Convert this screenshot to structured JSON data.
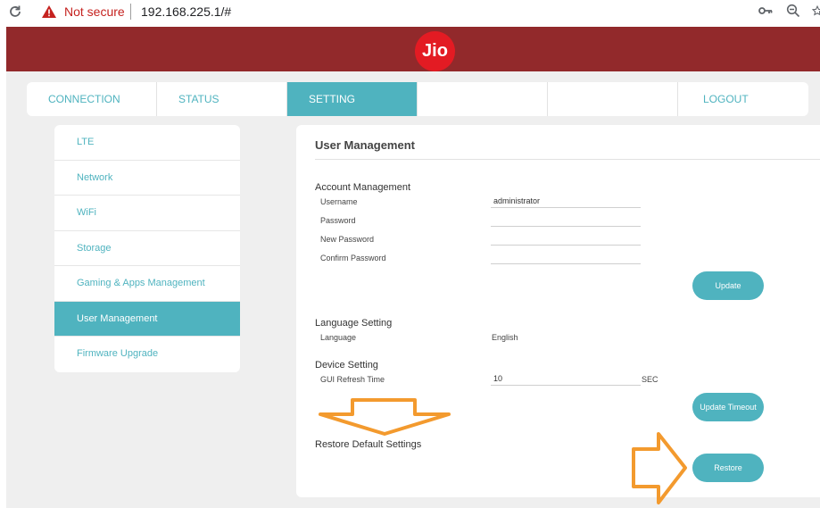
{
  "browser": {
    "security_text": "Not secure",
    "url": "192.168.225.1/#"
  },
  "brand": {
    "logo_text": "Jio"
  },
  "nav": {
    "items": [
      {
        "label": "CONNECTION"
      },
      {
        "label": "STATUS"
      },
      {
        "label": "SETTING"
      },
      {
        "label": ""
      },
      {
        "label": ""
      },
      {
        "label": "LOGOUT"
      }
    ],
    "active": "SETTING"
  },
  "sidebar": {
    "items": [
      {
        "label": "LTE"
      },
      {
        "label": "Network"
      },
      {
        "label": "WiFi"
      },
      {
        "label": "Storage"
      },
      {
        "label": "Gaming & Apps Management"
      },
      {
        "label": "User Management"
      },
      {
        "label": "Firmware Upgrade"
      }
    ],
    "active": "User Management"
  },
  "main": {
    "title": "User Management",
    "account": {
      "title": "Account Management",
      "username_label": "Username",
      "username_value": "administrator",
      "password_label": "Password",
      "new_password_label": "New Password",
      "confirm_password_label": "Confirm Password",
      "update_button": "Update"
    },
    "language": {
      "title": "Language Setting",
      "label": "Language",
      "value": "English"
    },
    "device": {
      "title": "Device Setting",
      "refresh_label": "GUI Refresh Time",
      "refresh_value": "10",
      "unit": "SEC",
      "update_timeout_button": "Update Timeout"
    },
    "restore": {
      "title": "Restore Default Settings",
      "button": "Restore"
    }
  },
  "colors": {
    "header": "#92292b",
    "accent": "#4fb3bf",
    "annotation_arrow": "#f39a2e",
    "logo": "#e31b23"
  }
}
